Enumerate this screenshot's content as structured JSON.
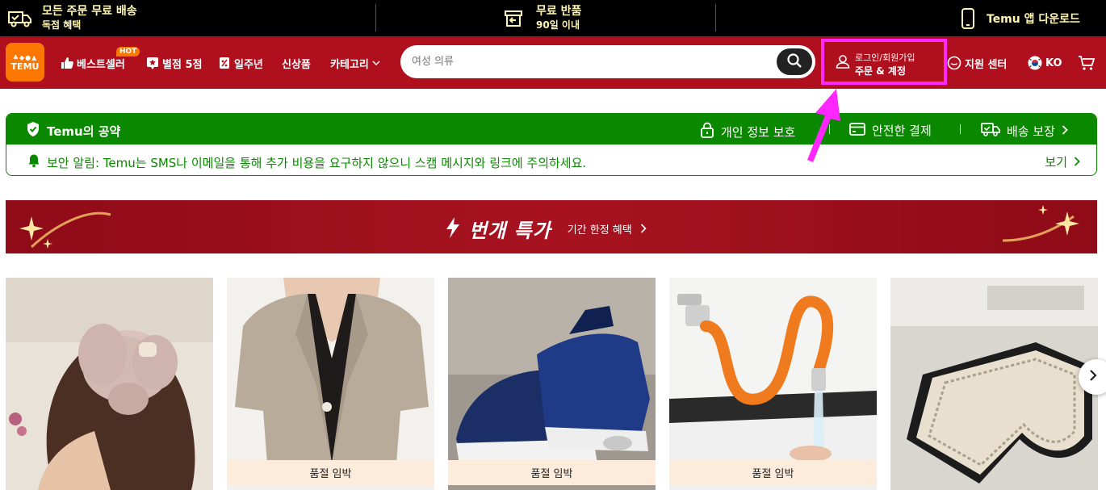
{
  "promo_bar": {
    "shipping_title": "모든 주문 무료 배송",
    "shipping_sub": "독점 혜택",
    "returns_title": "무료 반품",
    "returns_sub": "90일 이내",
    "app_download": "Temu 앱 다운로드"
  },
  "navbar": {
    "logo_text": "TEMU",
    "best_sellers": "베스트셀러",
    "hot_badge": "HOT",
    "five_star": "별점 5점",
    "anniversary": "일주년",
    "new_arrivals": "신상품",
    "categories": "카테고리",
    "search_placeholder": "여성 의류",
    "account_line1": "로그인/회원가입",
    "account_line2": "주문 & 계정",
    "support": "지원 센터",
    "language": "KO"
  },
  "pledge": {
    "title": "Temu의 공약",
    "privacy": "개인 정보 보호",
    "payment": "안전한 결제",
    "delivery": "배송 보장",
    "notice": "보안 알림: Temu는 SMS나 이메일을 통해 추가 비용을 요구하지 않으니 스캠 메시지와 링크에 주의하세요.",
    "view": "보기"
  },
  "flash_deal": {
    "title": "번개 특가",
    "subtitle": "기간 한정 혜택"
  },
  "products": [
    {
      "status": ""
    },
    {
      "status": "품절 임박"
    },
    {
      "status": "품절 임박"
    },
    {
      "status": "품절 임박"
    },
    {
      "status": ""
    }
  ],
  "colors": {
    "nav_red": "#b00f1e",
    "brand_orange": "#fb7701",
    "pledge_green": "#0a8800",
    "highlight_magenta": "#ff27ff",
    "promo_yellow": "#fff6b3"
  }
}
